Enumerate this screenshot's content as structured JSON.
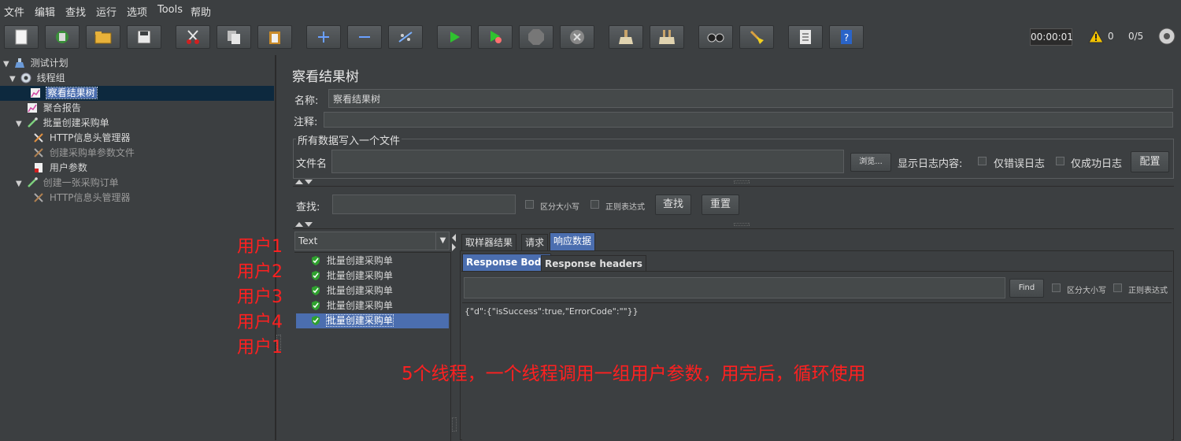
{
  "menu": [
    "文件",
    "编辑",
    "查找",
    "运行",
    "选项",
    "Tools",
    "帮助"
  ],
  "toolbar": {
    "buttons": [
      "new-icon",
      "templates-icon",
      "open-icon",
      "save-icon",
      "cut-icon",
      "copy-icon",
      "paste-icon",
      "expand-icon",
      "collapse-icon",
      "toggle-icon",
      "start-icon",
      "start-no-pauses-icon",
      "stop-icon",
      "shutdown-icon",
      "clear-icon",
      "clear-all-icon",
      "search-icon",
      "reset-search-icon",
      "function-helper-icon",
      "help-icon"
    ],
    "timer": "00:00:01",
    "warn_count": "0",
    "threads": "0/5"
  },
  "tree": [
    {
      "label": "测试计划",
      "icon": "flask-icon",
      "indent": 0,
      "expand": "▼"
    },
    {
      "label": "线程组",
      "icon": "gear-icon",
      "indent": 1,
      "expand": "▼"
    },
    {
      "label": "察看结果树",
      "icon": "graph-icon",
      "indent": 2,
      "expand": "",
      "selected": true
    },
    {
      "label": "聚合报告",
      "icon": "graph-icon",
      "indent": 2,
      "expand": ""
    },
    {
      "label": "批量创建采购单",
      "icon": "pipette-icon",
      "indent": 2,
      "expand": "▼"
    },
    {
      "label": "HTTP信息头管理器",
      "icon": "wrench-icon",
      "indent": 3,
      "expand": ""
    },
    {
      "label": "创建采购单参数文件",
      "icon": "wrench-icon",
      "indent": 3,
      "expand": "",
      "dim": true
    },
    {
      "label": "用户参数",
      "icon": "doc-icon",
      "indent": 3,
      "expand": ""
    },
    {
      "label": "创建一张采购订单",
      "icon": "pipette-icon",
      "indent": 2,
      "expand": "▼",
      "dim": true
    },
    {
      "label": "HTTP信息头管理器",
      "icon": "wrench-icon",
      "indent": 3,
      "expand": "",
      "dim": true
    }
  ],
  "panel": {
    "title": "察看结果树",
    "name_label": "名称:",
    "name_value": "察看结果树",
    "comment_label": "注释:",
    "file_group": "所有数据写入一个文件",
    "file_label": "文件名",
    "browse": "浏览...",
    "log_label": "显示日志内容:",
    "errors_only": "仅错误日志",
    "success_only": "仅成功日志",
    "configure": "配置"
  },
  "search": {
    "label": "查找:",
    "case": "区分大小写",
    "regex": "正则表达式",
    "find": "查找",
    "reset": "重置"
  },
  "renderer": "Text",
  "results": [
    "批量创建采购单",
    "批量创建采购单",
    "批量创建采购单",
    "批量创建采购单",
    "批量创建采购单"
  ],
  "result_tabs": [
    "取样器结果",
    "请求",
    "响应数据"
  ],
  "body_tabs": [
    "Response Body",
    "Response headers"
  ],
  "body_search": {
    "find": "Find",
    "case": "区分大小写",
    "regex": "正则表达式"
  },
  "response_text": "{\"d\":{\"isSuccess\":true,\"ErrorCode\":\"\"}}",
  "annotations": {
    "users": [
      "用户1",
      "用户2",
      "用户3",
      "用户4",
      "用户1"
    ],
    "note": "5个线程，一个线程调用一组用户参数，用完后，循环使用"
  },
  "colors": {
    "accent": "#4b6eaf",
    "annotation": "#ff2020",
    "bg": "#3c3f41"
  }
}
